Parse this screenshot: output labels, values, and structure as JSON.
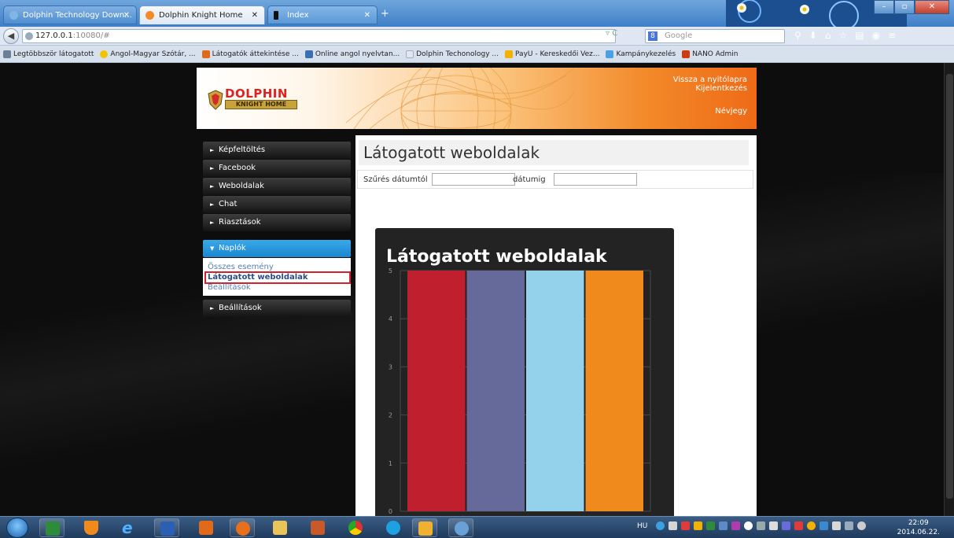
{
  "browser": {
    "tabs": [
      {
        "label": "Dolphin Technology Down...",
        "active": false
      },
      {
        "label": "Dolphin Knight Home",
        "active": true
      },
      {
        "label": "Index",
        "active": false
      }
    ],
    "url": "127.0.0.1",
    "url_port": ":10080/#",
    "search_placeholder": "Google",
    "bookmarks": [
      "Legtöbbször látogatott",
      "Angol-Magyar Szótár, ...",
      "Látogatók áttekintése ...",
      "Online angol nyelvtan...",
      "Dolphin Techonology ...",
      "PayU - Kereskedői Vez...",
      "Kampánykezelés",
      "NANO Admin"
    ]
  },
  "header": {
    "logo_line1": "DOLPHIN",
    "logo_line2": "KNIGHT HOME",
    "link_home": "Vissza a nyitólapra",
    "link_logout": "Kijelentkezés",
    "link_card": "Névjegy"
  },
  "sidebar": {
    "items_top": [
      "Képfeltöltés",
      "Facebook",
      "Weboldalak",
      "Chat",
      "Riasztások"
    ],
    "open_section": "Naplók",
    "sub_links": [
      "Összes esemény",
      "Látogatott weboldalak",
      "Beállítások"
    ],
    "items_bottom": [
      "Beállítások"
    ]
  },
  "main": {
    "title": "Látogatott weboldalak",
    "filter_from_label": "Szűrés dátumtól",
    "filter_to_label": "dátumig",
    "filter_from_value": "",
    "filter_to_value": ""
  },
  "chart_data": {
    "type": "bar",
    "title": "Látogatott weboldalak",
    "values": [
      5,
      5,
      5,
      5
    ],
    "colors": [
      "#c0202e",
      "#666a9a",
      "#93d2ea",
      "#f08a1c"
    ],
    "ylim": [
      0,
      5
    ],
    "yticks": [
      0,
      1,
      2,
      3,
      4,
      5
    ],
    "grid": true
  },
  "taskbar": {
    "lang": "HU",
    "time": "22:09",
    "date": "2014.06.22."
  }
}
